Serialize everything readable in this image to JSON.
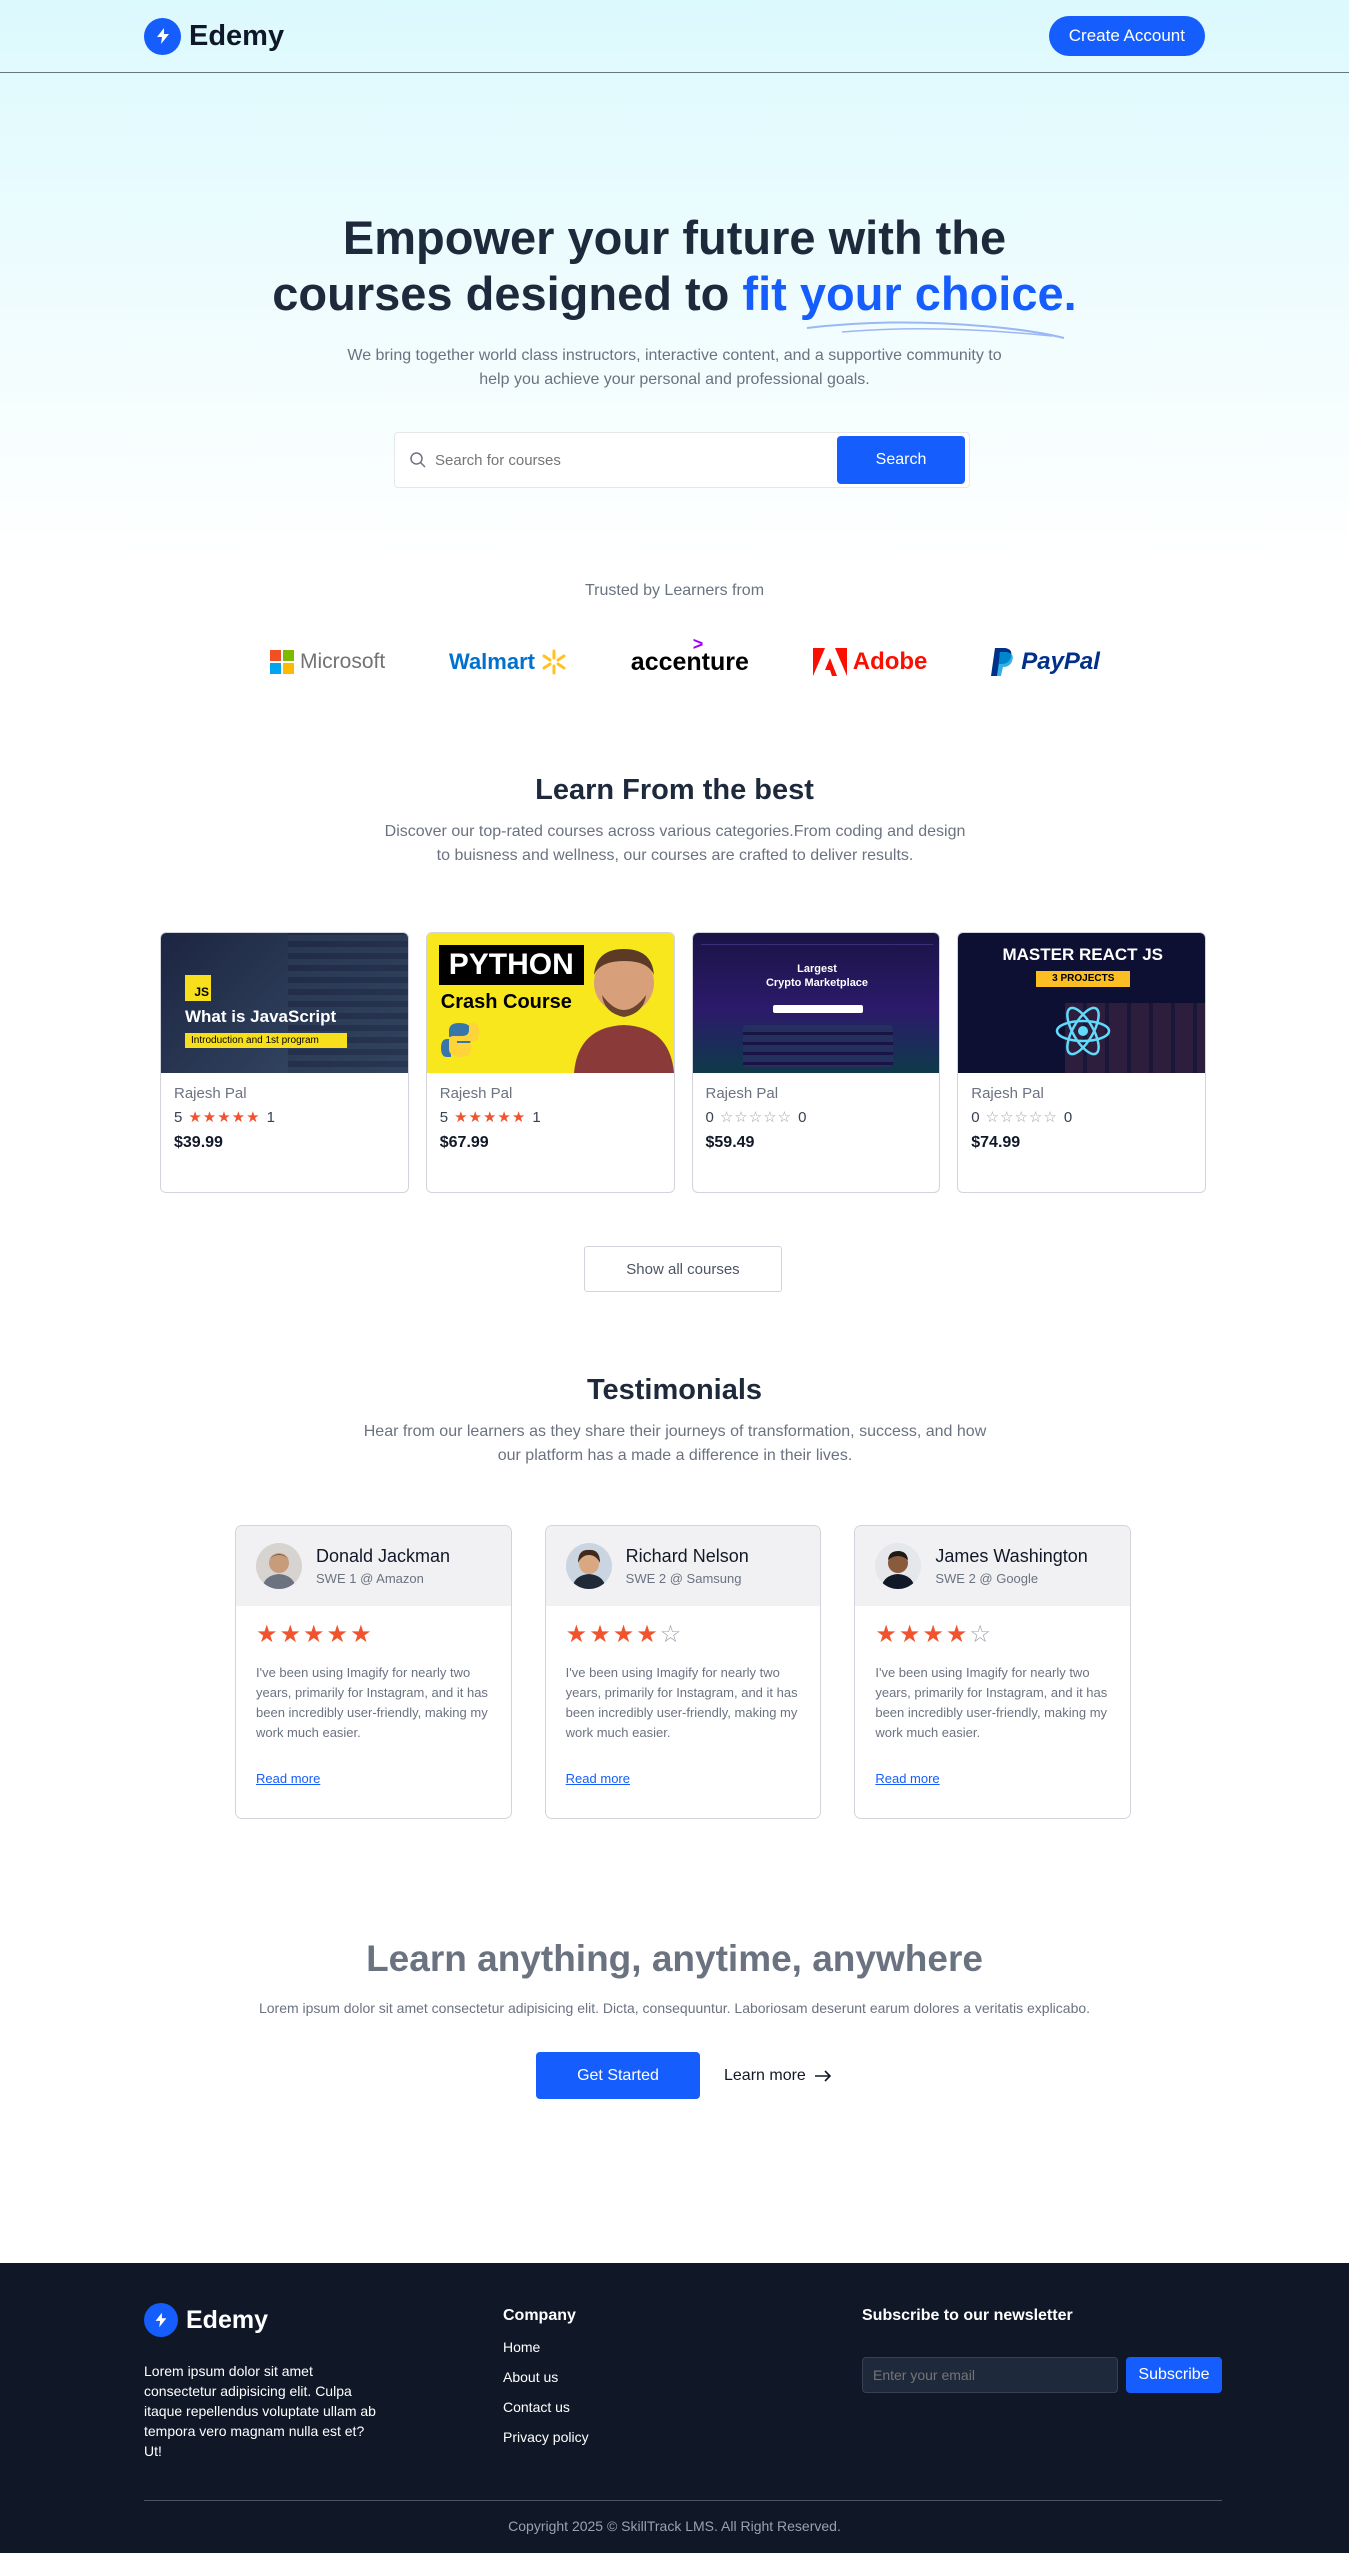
{
  "nav": {
    "brand": "Edemy",
    "cta": "Create Account"
  },
  "hero": {
    "title_line1": "Empower your future with the",
    "title_line2_prefix": "courses designed to ",
    "title_highlight": "fit your choice.",
    "subtitle": "We bring together world class instructors, interactive content, and a supportive community to help you achieve your personal and professional goals.",
    "search_placeholder": "Search for courses",
    "search_button": "Search"
  },
  "trusted": {
    "label": "Trusted by Learners from",
    "companies": [
      "Microsoft",
      "Walmart",
      "accenture",
      "Adobe",
      "PayPal"
    ]
  },
  "courses_section": {
    "title": "Learn From the best",
    "subtitle": "Discover our top-rated courses across various categories.From coding and design to buisness and wellness, our courses are crafted to deliver results.",
    "courses": [
      {
        "thumb_title": "What is JavaScript",
        "thumb_sub": "Introduction and 1st program",
        "thumb_badge": "JS",
        "author": "Rajesh Pal",
        "rating": "5",
        "stars": "★★★★★",
        "count": "1",
        "price": "$39.99"
      },
      {
        "thumb_title": "PYTHON",
        "thumb_sub": "Crash Course",
        "author": "Rajesh Pal",
        "rating": "5",
        "stars": "★★★★★",
        "count": "1",
        "price": "$67.99"
      },
      {
        "thumb_title": "Largest",
        "thumb_sub": "Crypto Marketplace",
        "author": "Rajesh Pal",
        "rating": "0",
        "stars": "☆☆☆☆☆",
        "count": "0",
        "price": "$59.49"
      },
      {
        "thumb_title": "MASTER REACT JS",
        "thumb_sub": "3 PROJECTS",
        "author": "Rajesh Pal",
        "rating": "0",
        "stars": "☆☆☆☆☆",
        "count": "0",
        "price": "$74.99"
      }
    ],
    "show_all": "Show all courses"
  },
  "testimonials": {
    "title": "Testimonials",
    "subtitle": "Hear from our learners as they share their journeys of transformation, success, and how our platform has a made a difference in their lives.",
    "items": [
      {
        "name": "Donald Jackman",
        "role": "SWE 1 @ Amazon",
        "rating": 5,
        "text": "I've been using Imagify for nearly two years, primarily for Instagram, and it has been incredibly user-friendly, making my work much easier.",
        "link": "Read more"
      },
      {
        "name": "Richard Nelson",
        "role": "SWE 2 @ Samsung",
        "rating": 4,
        "text": "I've been using Imagify for nearly two years, primarily for Instagram, and it has been incredibly user-friendly, making my work much easier.",
        "link": "Read more"
      },
      {
        "name": "James Washington",
        "role": "SWE 2 @ Google",
        "rating": 4,
        "text": "I've been using Imagify for nearly two years, primarily for Instagram, and it has been incredibly user-friendly, making my work much easier.",
        "link": "Read more"
      }
    ]
  },
  "cta": {
    "title": "Learn anything, anytime, anywhere",
    "subtitle": "Lorem ipsum dolor sit amet consectetur adipisicing elit. Dicta, consequuntur. Laboriosam deserunt earum dolores a veritatis explicabo.",
    "primary": "Get Started",
    "secondary": "Learn more"
  },
  "footer": {
    "brand": "Edemy",
    "description": "Lorem ipsum dolor sit amet consectetur adipisicing elit. Culpa itaque repellendus voluptate ullam ab tempora vero magnam nulla est et? Ut!",
    "company_title": "Company",
    "links": [
      "Home",
      "About us",
      "Contact us",
      "Privacy policy"
    ],
    "newsletter_title": "Subscribe to our newsletter",
    "email_placeholder": "Enter your email",
    "subscribe": "Subscribe",
    "copyright": "Copyright 2025 © SkillTrack LMS. All Right Reserved."
  },
  "colors": {
    "accent": "#155dfc",
    "star": "#f0532d",
    "footer_bg": "#101828"
  }
}
